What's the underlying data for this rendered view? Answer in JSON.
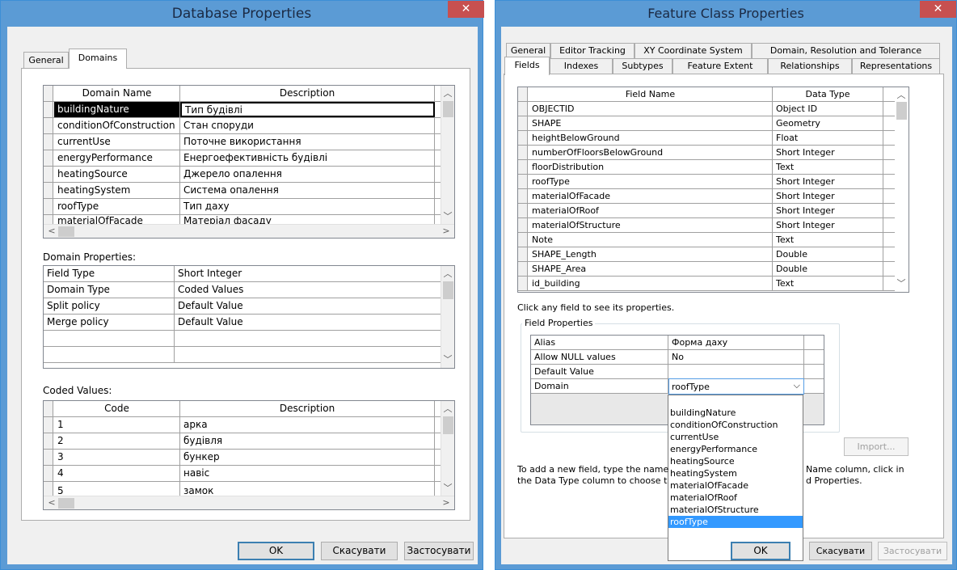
{
  "db": {
    "title": "Database Properties",
    "close": "✕",
    "tabs": [
      "General",
      "Domains"
    ],
    "domains": {
      "col_name": "Domain Name",
      "col_desc": "Description",
      "rows": [
        [
          "buildingNature",
          "Тип будівлі"
        ],
        [
          "conditionOfConstruction",
          "Стан споруди"
        ],
        [
          "currentUse",
          "Поточне використання"
        ],
        [
          "energyPerformance",
          "Енергоефективність будівлі"
        ],
        [
          "heatingSource",
          "Джерело опалення"
        ],
        [
          "heatingSystem",
          "Система опалення"
        ],
        [
          "roofType",
          "Тип даху"
        ],
        [
          "materialOfFacade",
          "Матеріал фасаду"
        ]
      ]
    },
    "props_label": "Domain Properties:",
    "props": [
      [
        "Field Type",
        "Short Integer"
      ],
      [
        "Domain Type",
        "Coded Values"
      ],
      [
        "Split policy",
        "Default Value"
      ],
      [
        "Merge policy",
        "Default Value"
      ],
      [
        "",
        ""
      ],
      [
        "",
        ""
      ],
      [
        "",
        ""
      ]
    ],
    "coded_label": "Coded Values:",
    "coded": {
      "col_code": "Code",
      "col_desc": "Description",
      "rows": [
        [
          "1",
          "арка"
        ],
        [
          "2",
          "будівля"
        ],
        [
          "3",
          "бункер"
        ],
        [
          "4",
          "навіс"
        ],
        [
          "5",
          "замок"
        ]
      ]
    },
    "ok": "OK",
    "cancel": "Скасувати",
    "apply": "Застосувати"
  },
  "fc": {
    "title": "Feature Class Properties",
    "close": "✕",
    "tabs_row1": [
      "General",
      "Editor Tracking",
      "XY Coordinate System",
      "Domain, Resolution and Tolerance"
    ],
    "tabs_row2": [
      "Fields",
      "Indexes",
      "Subtypes",
      "Feature Extent",
      "Relationships",
      "Representations"
    ],
    "fields": {
      "col_name": "Field Name",
      "col_type": "Data Type",
      "rows": [
        [
          "OBJECTID",
          "Object ID"
        ],
        [
          "SHAPE",
          "Geometry"
        ],
        [
          "heightBelowGround",
          "Float"
        ],
        [
          "numberOfFloorsBelowGround",
          "Short Integer"
        ],
        [
          "floorDistribution",
          "Text"
        ],
        [
          "roofType",
          "Short Integer"
        ],
        [
          "materialOfFacade",
          "Short Integer"
        ],
        [
          "materialOfRoof",
          "Short Integer"
        ],
        [
          "materialOfStructure",
          "Short Integer"
        ],
        [
          "Note",
          "Text"
        ],
        [
          "SHAPE_Length",
          "Double"
        ],
        [
          "SHAPE_Area",
          "Double"
        ],
        [
          "id_building",
          "Text"
        ]
      ]
    },
    "hint": "Click any field to see its properties.",
    "fp_label": "Field Properties",
    "fp_rows": [
      [
        "Alias",
        "Форма даху"
      ],
      [
        "Allow NULL values",
        "No"
      ],
      [
        "Default Value",
        ""
      ],
      [
        "Domain",
        "roofType"
      ]
    ],
    "dropdown": [
      "",
      "buildingNature",
      "conditionOfConstruction",
      "currentUse",
      "energyPerformance",
      "heatingSource",
      "heatingSystem",
      "materialOfFacade",
      "materialOfRoof",
      "materialOfStructure",
      "roofType"
    ],
    "import": "Import...",
    "footer_line1_a": "To add a new field, type the name",
    "footer_line1_b": "Name column, click in",
    "footer_line2_a": "the Data Type column to choose t",
    "footer_line2_b": "d Properties.",
    "ok": "OK",
    "cancel": "Скасувати",
    "apply": "Застосувати"
  }
}
